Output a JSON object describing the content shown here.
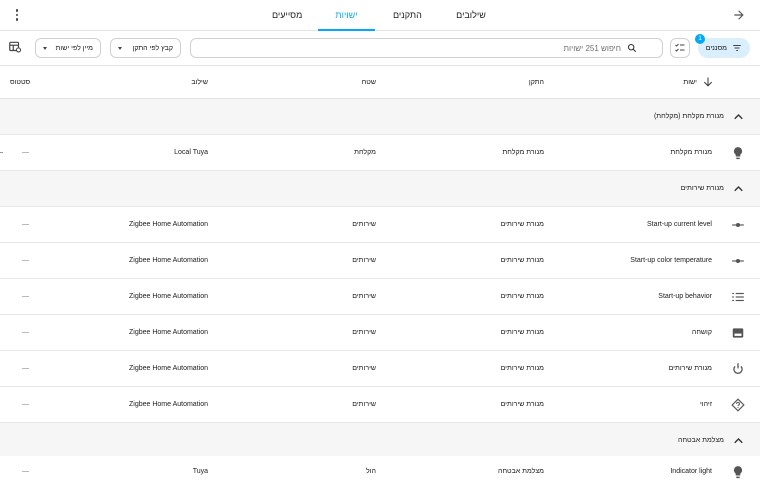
{
  "tabs": [
    {
      "label": "שילובים",
      "active": false
    },
    {
      "label": "התקנים",
      "active": false
    },
    {
      "label": "ישויות",
      "active": true
    },
    {
      "label": "מסייעים",
      "active": false
    }
  ],
  "toolbar": {
    "filters_label": "מסננים",
    "filters_count": "1",
    "search_placeholder": "חיפוש 251 ישויות",
    "group_by_label": "קבץ לפי התקן",
    "sort_by_label": "מיין לפי ישות"
  },
  "columns": {
    "entity": "ישות",
    "device": "התקן",
    "area": "שטח",
    "integration": "שילוב",
    "status": "סטטוס"
  },
  "groups": [
    {
      "label": "מנורת מקלחת (מקלחת)",
      "rows": [
        {
          "icon": "bulb-icon",
          "name": "מנורת מקלחת",
          "device": "מנורת מקלחת",
          "area": "מקלחת",
          "integration": "Local Tuya",
          "status": "—"
        }
      ]
    },
    {
      "label": "מנורת שירותים",
      "rows": [
        {
          "icon": "slider-icon",
          "name": "Start-up current level",
          "device": "מנורת שירותים",
          "area": "שירותים",
          "integration": "Zigbee Home Automation",
          "status": "—"
        },
        {
          "icon": "slider-icon",
          "name": "Start-up color temperature",
          "device": "מנורת שירותים",
          "area": "שירותים",
          "integration": "Zigbee Home Automation",
          "status": "—"
        },
        {
          "icon": "list-icon",
          "name": "Start-up behavior",
          "device": "מנורת שירותים",
          "area": "שירותים",
          "integration": "Zigbee Home Automation",
          "status": "—"
        },
        {
          "icon": "panel-icon",
          "name": "קושחה",
          "device": "מנורת שירותים",
          "area": "שירותים",
          "integration": "Zigbee Home Automation",
          "status": "—"
        },
        {
          "icon": "power-icon",
          "name": "מנורת שירותים",
          "device": "מנורת שירותים",
          "area": "שירותים",
          "integration": "Zigbee Home Automation",
          "status": "—"
        },
        {
          "icon": "help-icon",
          "name": "זיהוי",
          "device": "מנורת שירותים",
          "area": "שירותים",
          "integration": "Zigbee Home Automation",
          "status": "—"
        }
      ]
    },
    {
      "label": "מצלמת אבטחה",
      "rows": [
        {
          "icon": "bulb-icon",
          "name": "Indicator light",
          "device": "מצלמת אבטחה",
          "area": "הול",
          "integration": "Tuya",
          "status": "—"
        }
      ]
    }
  ]
}
